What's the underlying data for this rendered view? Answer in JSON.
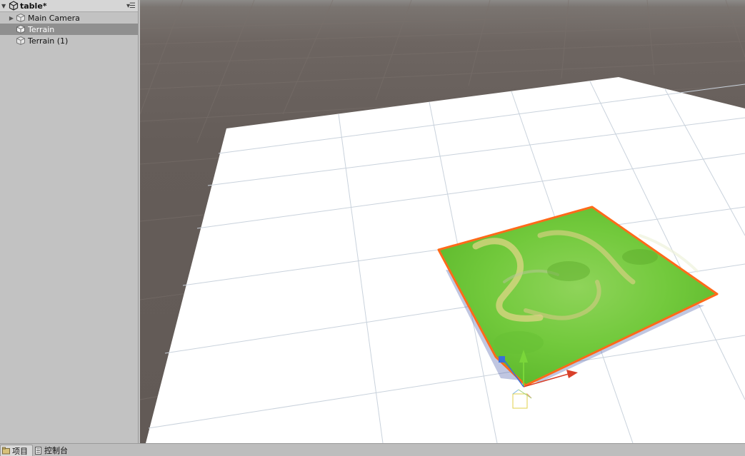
{
  "hierarchy": {
    "scene_name": "table*",
    "items": [
      {
        "label": "Main Camera",
        "expandable": true,
        "selected": false
      },
      {
        "label": "Terrain",
        "expandable": false,
        "selected": true
      },
      {
        "label": "Terrain (1)",
        "expandable": false,
        "selected": false
      }
    ]
  },
  "bottom_tabs": [
    {
      "label": "项目",
      "active": true
    },
    {
      "label": "控制台",
      "active": false
    }
  ],
  "colors": {
    "selection_outline": "#ff6a1a",
    "terrain_green": "#6fcf3a",
    "gizmo_y": "#7ad63a",
    "gizmo_x": "#d8402a",
    "gizmo_z": "#3a6fd8"
  }
}
